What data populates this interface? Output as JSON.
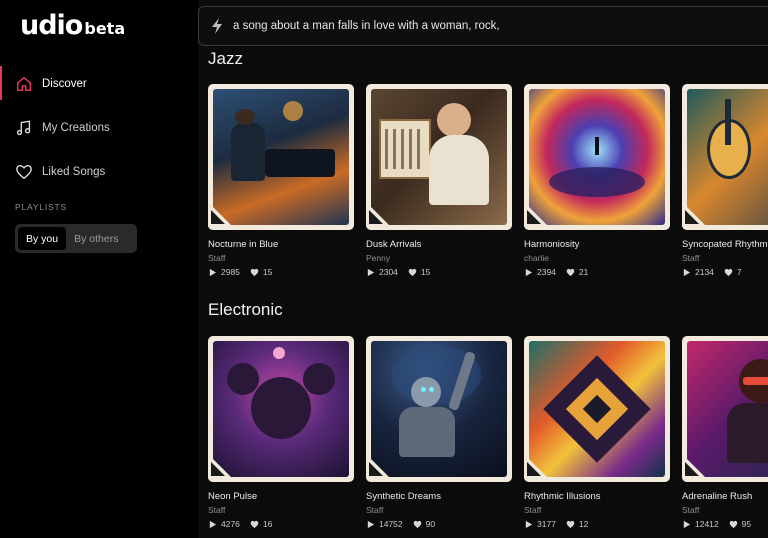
{
  "brand": {
    "name": "udio",
    "badge": "beta"
  },
  "sidebar": {
    "items": [
      {
        "label": "Discover",
        "icon": "home-icon",
        "active": true
      },
      {
        "label": "My Creations",
        "icon": "music-note-icon",
        "active": false
      },
      {
        "label": "Liked Songs",
        "icon": "heart-icon",
        "active": false
      }
    ],
    "playlists_label": "PLAYLISTS",
    "toggle": {
      "by_you": "By you",
      "by_others": "By others",
      "selected": "By you"
    }
  },
  "prompt": {
    "value": "a song about a man falls in love with a woman, rock,",
    "icon": "lightning-icon"
  },
  "colors": {
    "accent": "#e8355b",
    "background": "#0b0b0c",
    "sidebar": "#000000"
  },
  "sections": [
    {
      "title": "Jazz",
      "songs": [
        {
          "title": "Nocturne in Blue",
          "artist": "Staff",
          "plays": "2985",
          "likes": "15"
        },
        {
          "title": "Dusk Arrivals",
          "artist": "Penny",
          "plays": "2304",
          "likes": "15"
        },
        {
          "title": "Harmoniosity",
          "artist": "charlie",
          "plays": "2394",
          "likes": "21"
        },
        {
          "title": "Syncopated Rhythm",
          "artist": "Staff",
          "plays": "2134",
          "likes": "7"
        }
      ]
    },
    {
      "title": "Electronic",
      "songs": [
        {
          "title": "Neon Pulse",
          "artist": "Staff",
          "plays": "4276",
          "likes": "16"
        },
        {
          "title": "Synthetic Dreams",
          "artist": "Staff",
          "plays": "14752",
          "likes": "90"
        },
        {
          "title": "Rhythmic Illusions",
          "artist": "Staff",
          "plays": "3177",
          "likes": "12"
        },
        {
          "title": "Adrenaline Rush",
          "artist": "Staff",
          "plays": "12412",
          "likes": "95"
        }
      ]
    }
  ]
}
